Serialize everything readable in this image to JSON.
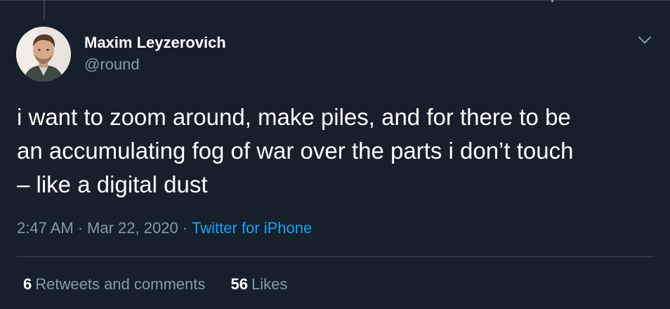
{
  "author": {
    "name": "Maxim Leyzerovich",
    "handle": "@round"
  },
  "tweet": {
    "text": "i want to zoom around, make piles, and for there to be\nan accumulating fog of war over the parts i don’t touch\n– like a digital dust",
    "time": "2:47 AM",
    "separator": "·",
    "date": "Mar 22, 2020",
    "source": "Twitter for iPhone"
  },
  "stats": {
    "retweets_count": "6",
    "retweets_label": "Retweets and comments",
    "likes_count": "56",
    "likes_label": "Likes"
  },
  "icons": {
    "menu": "chevron-down-icon"
  },
  "colors": {
    "background": "#15202b",
    "text_primary": "#ffffff",
    "text_secondary": "#8899a6",
    "link": "#1da1f2",
    "border": "#38444d"
  }
}
